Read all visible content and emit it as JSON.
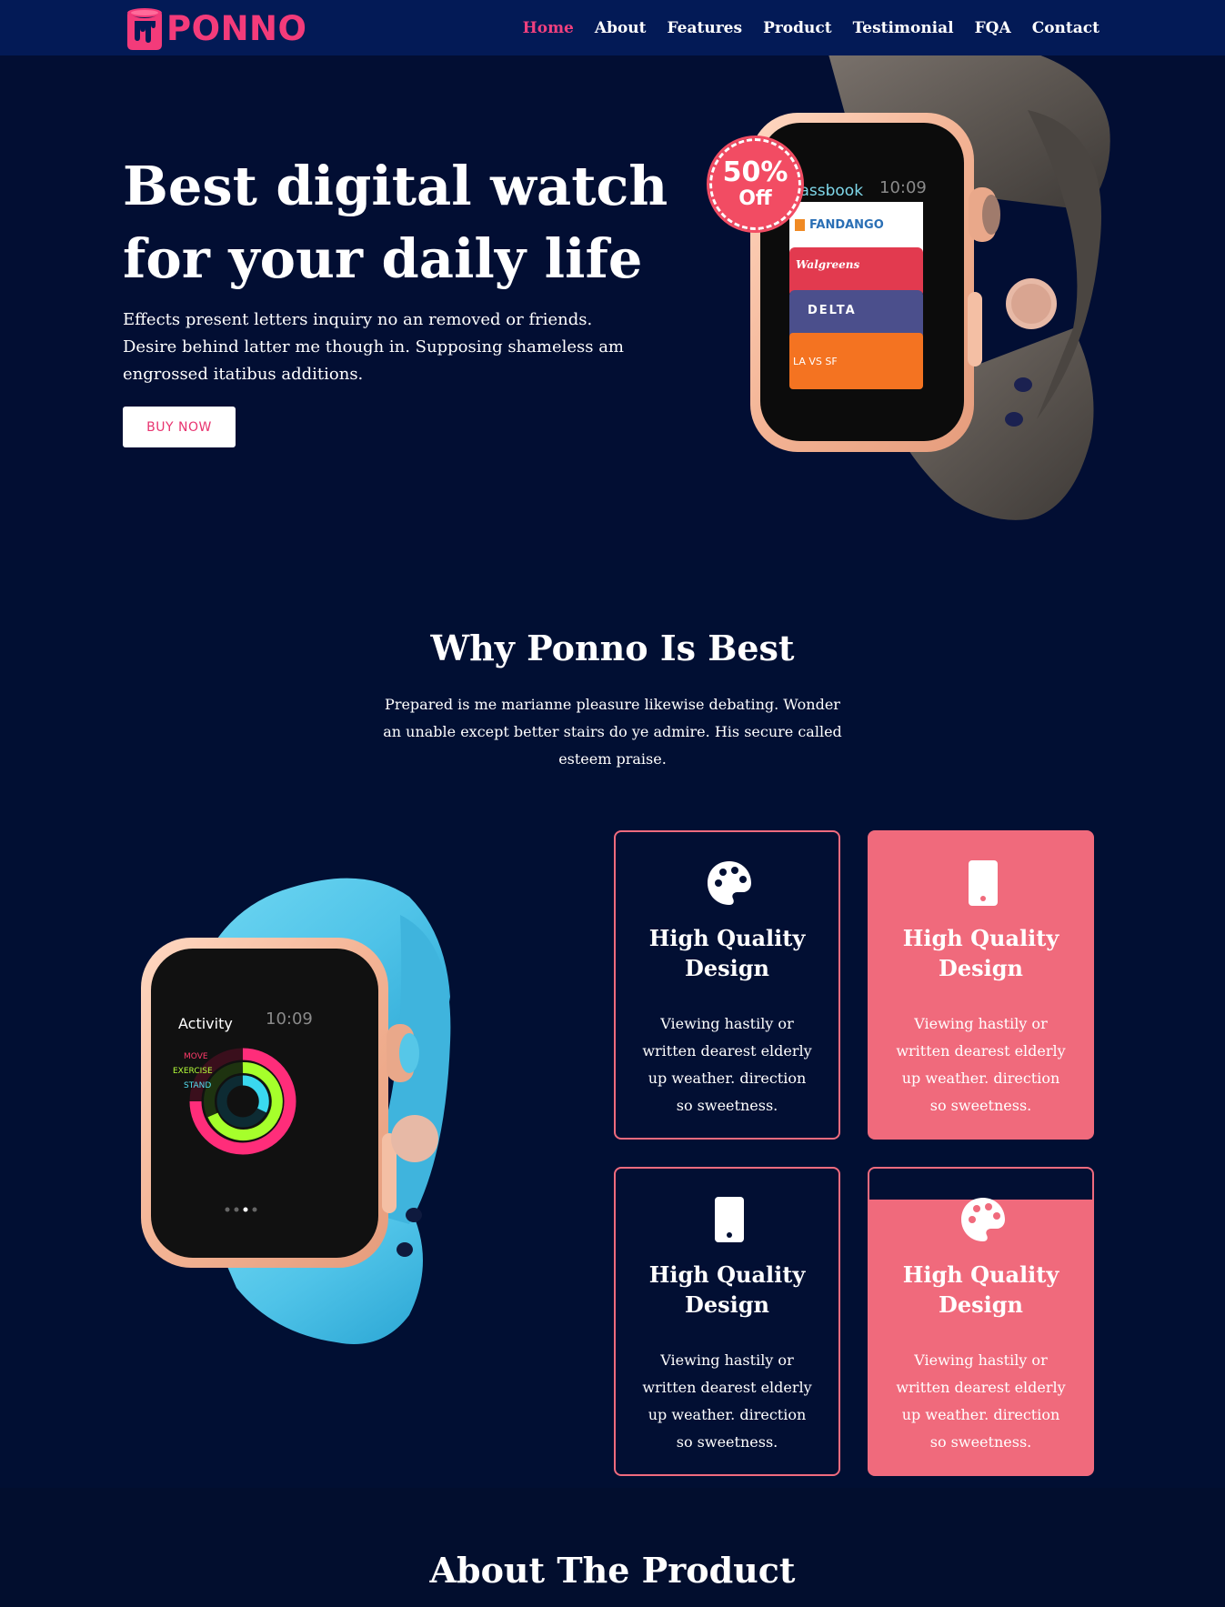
{
  "brand": {
    "name": "PONNO",
    "color": "#f33b7a"
  },
  "nav": {
    "items": [
      "Home",
      "About",
      "Features",
      "Product",
      "Testimonial",
      "FQA",
      "Contact"
    ],
    "active_index": 0,
    "active_color": "#f0407e"
  },
  "hero": {
    "title_line1": "Best digital watch",
    "title_line2": "for your daily life",
    "text": "Effects present letters inquiry no an removed or friends. Desire behind latter me though in. Supposing shameless am engrossed itatibus additions.",
    "button_label": "BUY NOW",
    "badge_percent": "50%",
    "badge_label": "Off",
    "watch_screen": {
      "app": "Passbook",
      "time": "10:09",
      "passes": [
        "FANDANGO",
        "Walgreens",
        "DELTA",
        "LA VS SF"
      ]
    }
  },
  "why": {
    "title": "Why Ponno Is Best",
    "text": "Prepared is me marianne pleasure likewise debating. Wonder an unable except better stairs do ye admire. His secure called esteem praise.",
    "watch_screen": {
      "app": "Activity",
      "time": "10:09",
      "rings": [
        "MOVE",
        "EXERCISE",
        "STAND"
      ]
    },
    "cards": [
      {
        "icon": "palette-icon",
        "title": "High Quality Design",
        "text": "Viewing hastily or written dearest elderly up weather. direction so sweetness.",
        "style": "dark"
      },
      {
        "icon": "mobile-icon",
        "title": "High Quality Design",
        "text": "Viewing hastily or written dearest elderly up weather. direction so sweetness.",
        "style": "pink"
      },
      {
        "icon": "mobile-icon",
        "title": "High Quality Design",
        "text": "Viewing hastily or written dearest elderly up weather. direction so sweetness.",
        "style": "dark"
      },
      {
        "icon": "palette-icon",
        "title": "High Quality Design",
        "text": "Viewing hastily or written dearest elderly up weather. direction so sweetness.",
        "style": "split"
      }
    ]
  },
  "about": {
    "title": "About The Product"
  },
  "colors": {
    "background": "#020e2e",
    "navbar": "#031a56",
    "accent_pink": "#f06a7c",
    "band_blue": "#55c8ea"
  }
}
